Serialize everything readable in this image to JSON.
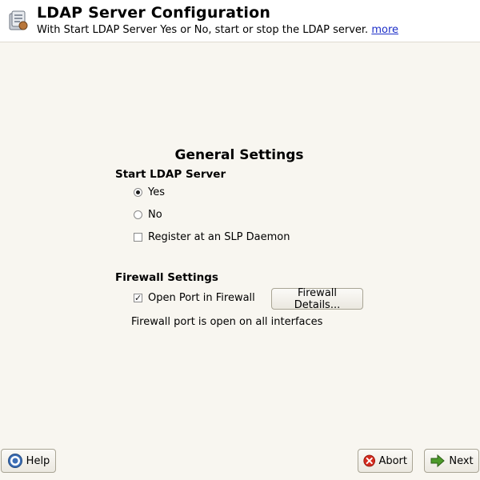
{
  "header": {
    "title": "LDAP Server Configuration",
    "subtitle": "With Start LDAP Server Yes or No, start or stop the LDAP server.",
    "more_link": "more"
  },
  "general": {
    "section_title": "General Settings",
    "start_label": "Start LDAP Server",
    "options": [
      {
        "label": "Yes",
        "checked": true
      },
      {
        "label": "No",
        "checked": false
      }
    ],
    "register_slp": {
      "label": "Register at an SLP Daemon",
      "checked": false
    }
  },
  "firewall": {
    "label": "Firewall Settings",
    "open_port": {
      "label": "Open Port in Firewall",
      "checked": true
    },
    "details_button": "Firewall Details...",
    "status": "Firewall port is open on all interfaces"
  },
  "footer": {
    "help_label": "Help",
    "abort_label": "Abort",
    "next_label": "Next"
  },
  "icons": {
    "app": "ldap-config-icon",
    "help": "help-icon",
    "abort": "abort-icon",
    "next": "next-arrow-icon"
  },
  "colors": {
    "background": "#f8f6f0",
    "header_bg": "#ffffff",
    "link": "#1c2ec8",
    "abort_red": "#d42a1e",
    "next_green": "#4c9a2a"
  }
}
